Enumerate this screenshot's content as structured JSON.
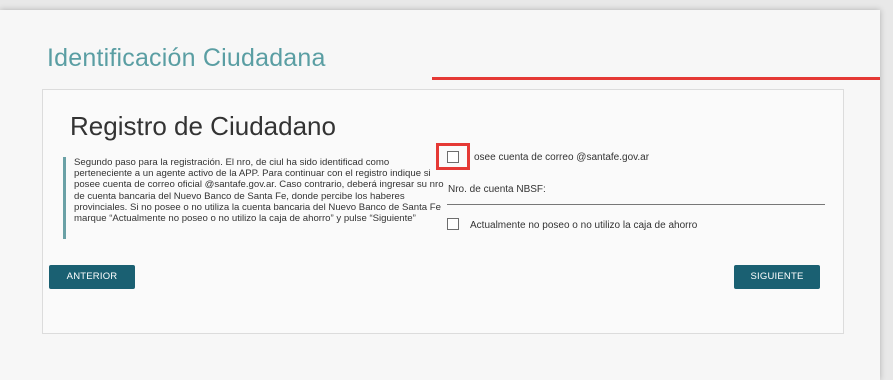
{
  "page": {
    "title": "Identificación Ciudadana"
  },
  "card": {
    "title": "Registro de Ciudadano",
    "info": "Segundo paso para la registración. El nro, de ciul ha sido identificad como perteneciente a un agente activo de la APP. Para continuar con el registro indique si posee cuenta de correo oficial @santafe.gov.ar. Caso contrario, deberá ingresar su nro de cuenta bancaria del Nuevo Banco de Santa Fe, donde percibe los haberes provinciales. Si no posee o no utiliza la cuenta bancaria del Nuevo Banco de Santa Fe marque “Actualmente no poseo o no utilizo la caja de ahorro” y pulse “Siguiente”"
  },
  "form": {
    "email_checkbox_label": "osee cuenta de correo @santafe.gov.ar",
    "account_field_label": "Nro. de cuenta NBSF:",
    "account_field_value": "",
    "no_account_checkbox_label": "Actualmente no poseo o no utilizo la caja de ahorro"
  },
  "buttons": {
    "prev": "ANTERIOR",
    "next": "SIGUIENTE"
  },
  "colors": {
    "accent": "#5a9ea3",
    "button": "#1a6072",
    "highlight": "#e53935"
  }
}
